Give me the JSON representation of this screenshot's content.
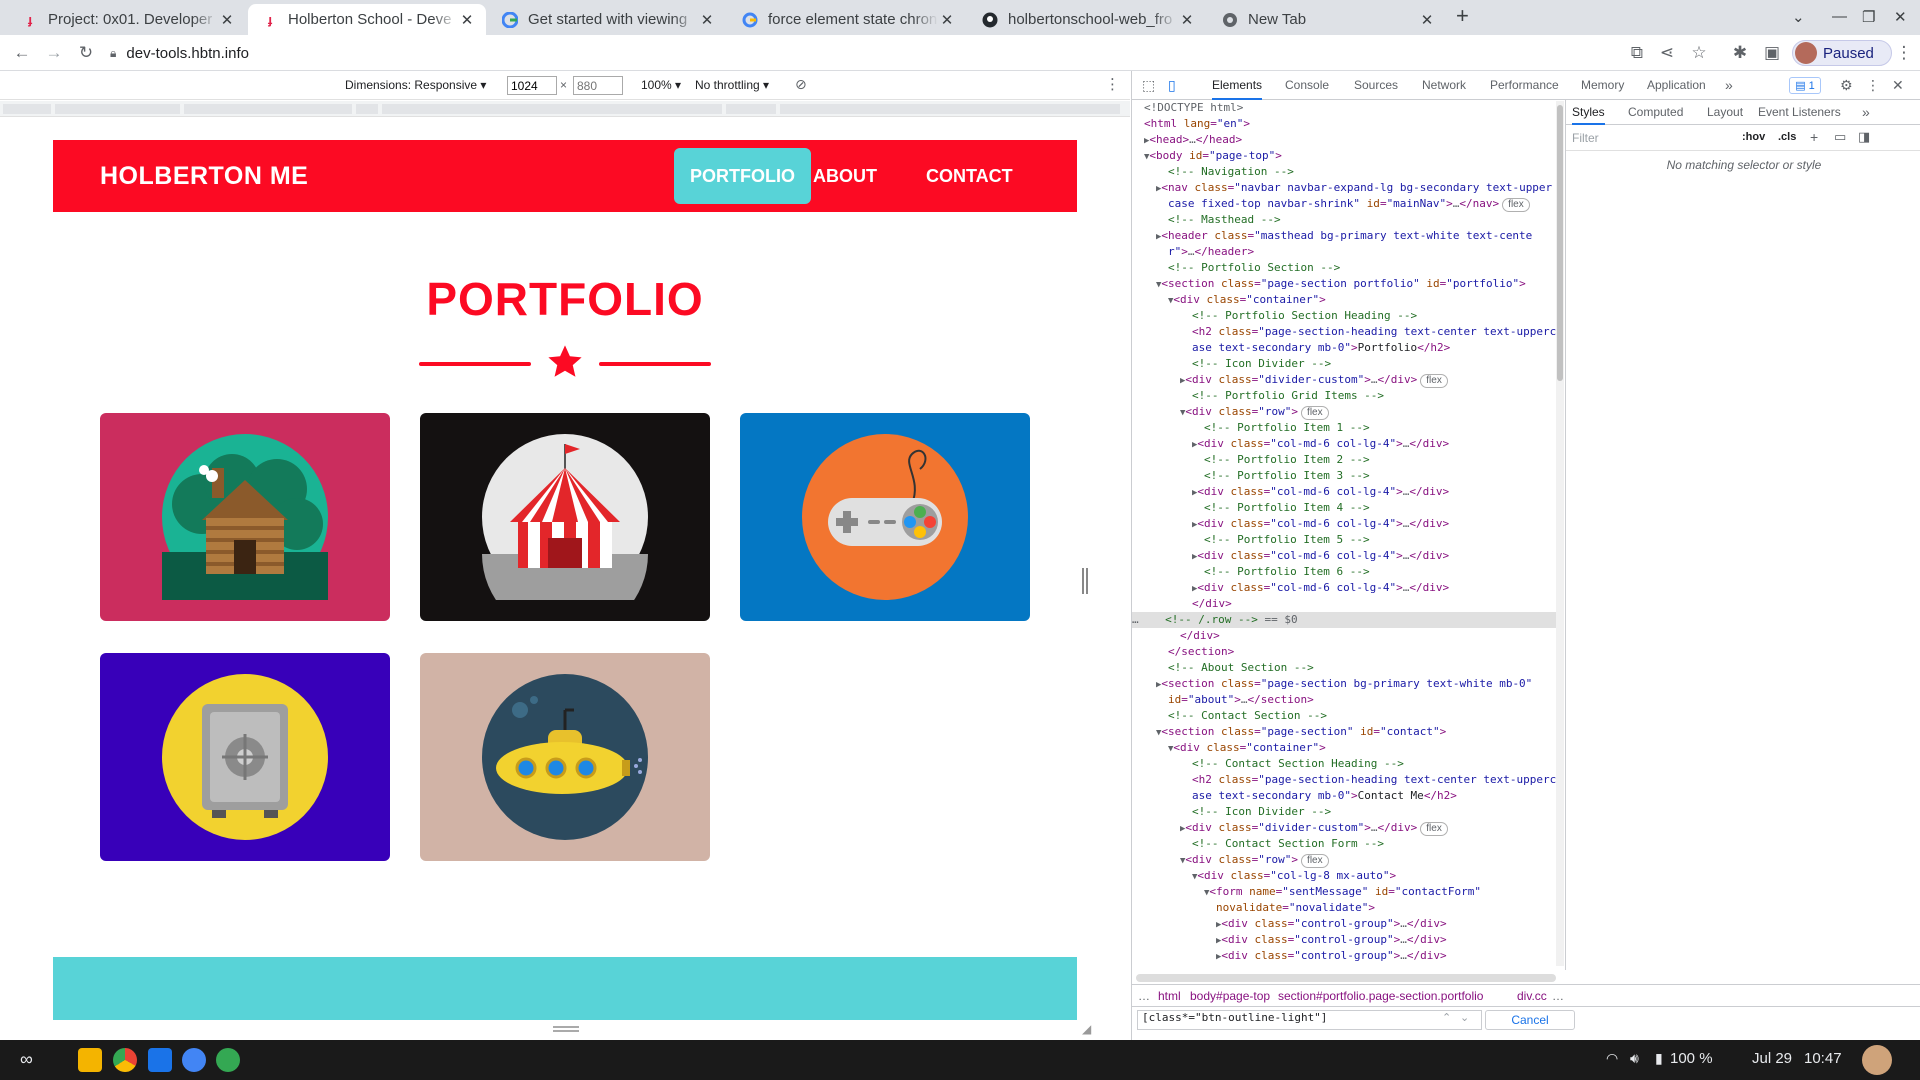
{
  "browser": {
    "tabs": [
      {
        "title": "Project: 0x01. Developer"
      },
      {
        "title": "Holberton School - Deve"
      },
      {
        "title": "Get started with viewing"
      },
      {
        "title": "force element state chron"
      },
      {
        "title": "holbertonschool-web_fro"
      },
      {
        "title": "New Tab"
      }
    ],
    "new_tab": "+",
    "url": "dev-tools.hbtn.info",
    "profile_label": "Paused"
  },
  "device_toolbar": {
    "dimensions": "Dimensions: Responsive ▾",
    "width": "1024",
    "times": "×",
    "height_placeholder": "880",
    "zoom": "100% ▾",
    "throttling": "No throttling ▾"
  },
  "site": {
    "brand": "HOLBERTON ME",
    "nav": [
      "PORTFOLIO",
      "ABOUT",
      "CONTACT"
    ],
    "section_title": "PORTFOLIO",
    "portfolio_items": [
      {
        "name": "cabin",
        "bg": "#cb2d5e"
      },
      {
        "name": "circus",
        "bg": "#141111"
      },
      {
        "name": "game controller",
        "bg": "#0477c3"
      },
      {
        "name": "safe",
        "bg": "#3800b9"
      },
      {
        "name": "submarine",
        "bg": "#d1b3a6"
      }
    ],
    "colors": {
      "primary": "#fc0a23",
      "secondary": "#58d3d7"
    }
  },
  "devtools": {
    "tabs": [
      "Elements",
      "Console",
      "Sources",
      "Network",
      "Performance",
      "Memory",
      "Application"
    ],
    "more": "»",
    "issues_count": "1",
    "styles_tabs": [
      "Styles",
      "Computed",
      "Layout",
      "Event Listeners"
    ],
    "filter_placeholder": "Filter",
    "hov": ":hov",
    "cls": ".cls",
    "no_match": "No matching selector or style",
    "breadcrumbs": [
      "html",
      "body#page-top",
      "section#portfolio.page-section.portfolio",
      "div.cc"
    ],
    "search_value": "[class*=\"btn-outline-light\"]",
    "cancel_label": "Cancel"
  },
  "taskbar": {
    "battery": "100 %",
    "date": "Jul 29",
    "time": "10:47"
  }
}
